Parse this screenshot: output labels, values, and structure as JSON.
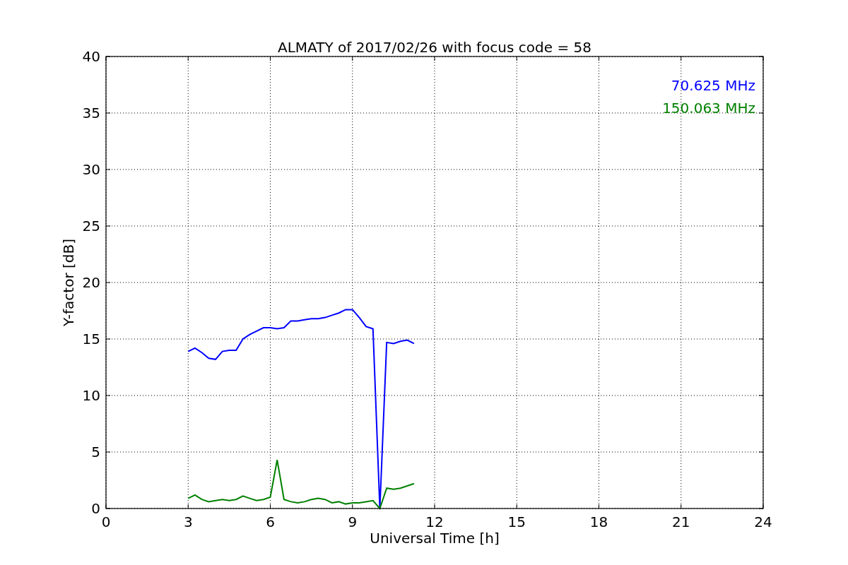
{
  "chart_data": {
    "type": "line",
    "title": "ALMATY of 2017/02/26 with focus code = 58",
    "xlabel": "Universal Time [h]",
    "ylabel": "Y-factor [dB]",
    "x": [
      3,
      3.25,
      3.5,
      3.75,
      4,
      4.25,
      4.5,
      4.75,
      5,
      5.25,
      5.5,
      5.75,
      6,
      6.25,
      6.5,
      6.75,
      7,
      7.25,
      7.5,
      7.75,
      8,
      8.25,
      8.5,
      8.75,
      9,
      9.25,
      9.5,
      9.75,
      10,
      10.25,
      10.5,
      10.75,
      11,
      11.25
    ],
    "series": [
      {
        "name": "70.625 MHz",
        "color": "#0000ff",
        "values": [
          13.9,
          14.2,
          13.8,
          13.3,
          13.2,
          13.9,
          14.0,
          14.0,
          15.0,
          15.4,
          15.7,
          16.0,
          16.0,
          15.9,
          16.0,
          16.6,
          16.6,
          16.7,
          16.8,
          16.8,
          16.9,
          17.1,
          17.3,
          17.6,
          17.6,
          16.9,
          16.1,
          15.9,
          0,
          14.7,
          14.6,
          14.8,
          14.9,
          14.6
        ]
      },
      {
        "name": "150.063 MHz",
        "color": "#008000",
        "values": [
          0.9,
          1.2,
          0.8,
          0.6,
          0.7,
          0.8,
          0.7,
          0.8,
          1.1,
          0.9,
          0.7,
          0.8,
          1.0,
          4.3,
          0.8,
          0.6,
          0.5,
          0.6,
          0.8,
          0.9,
          0.8,
          0.5,
          0.6,
          0.4,
          0.5,
          0.5,
          0.6,
          0.7,
          0,
          1.8,
          1.7,
          1.8,
          2.0,
          2.2
        ]
      }
    ],
    "grid": true,
    "xlim": [
      0,
      24
    ],
    "ylim": [
      0,
      40
    ],
    "xticks": [
      0,
      3,
      6,
      9,
      12,
      15,
      18,
      21,
      24
    ],
    "yticks": [
      0,
      5,
      10,
      15,
      20,
      25,
      30,
      35,
      40
    ]
  }
}
